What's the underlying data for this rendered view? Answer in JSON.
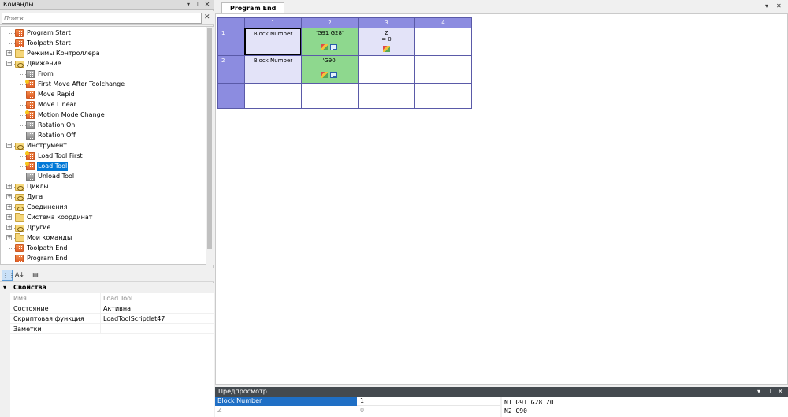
{
  "left_panel": {
    "title": "Команды",
    "search_placeholder": "Поиск...",
    "tree": [
      {
        "label": "Program Start",
        "icon": "red-block-icon",
        "level": 1,
        "expander": ""
      },
      {
        "label": "Toolpath Start",
        "icon": "red-block-icon",
        "level": 1,
        "expander": ""
      },
      {
        "label": "Режимы Контроллера",
        "icon": "folder-icon",
        "level": 1,
        "expander": "+"
      },
      {
        "label": "Движение",
        "icon": "folder-open-icon",
        "level": 1,
        "expander": "−"
      },
      {
        "label": "From",
        "icon": "grey-block-icon",
        "level": 2,
        "expander": ""
      },
      {
        "label": "First Move After Toolchange",
        "icon": "red-star-block-icon",
        "level": 2,
        "expander": ""
      },
      {
        "label": "Move Rapid",
        "icon": "red-block-icon",
        "level": 2,
        "expander": ""
      },
      {
        "label": "Move Linear",
        "icon": "red-block-icon",
        "level": 2,
        "expander": ""
      },
      {
        "label": "Motion Mode Change",
        "icon": "red-star-block-icon",
        "level": 2,
        "expander": ""
      },
      {
        "label": "Rotation On",
        "icon": "grey-block-icon",
        "level": 2,
        "expander": ""
      },
      {
        "label": "Rotation Off",
        "icon": "grey-block-icon",
        "level": 2,
        "expander": ""
      },
      {
        "label": "Инструмент",
        "icon": "folder-open-icon",
        "level": 1,
        "expander": "−"
      },
      {
        "label": "Load Tool First",
        "icon": "red-star-block-icon",
        "level": 2,
        "expander": ""
      },
      {
        "label": "Load Tool",
        "icon": "red-star-block-icon",
        "level": 2,
        "expander": "",
        "selected": true
      },
      {
        "label": "Unload Tool",
        "icon": "grey-block-icon",
        "level": 2,
        "expander": ""
      },
      {
        "label": "Циклы",
        "icon": "folder-open-icon",
        "level": 1,
        "expander": "+"
      },
      {
        "label": "Дуга",
        "icon": "folder-open-icon",
        "level": 1,
        "expander": "+"
      },
      {
        "label": "Соединения",
        "icon": "folder-open-icon",
        "level": 1,
        "expander": "+"
      },
      {
        "label": "Система координат",
        "icon": "folder-icon",
        "level": 1,
        "expander": "+"
      },
      {
        "label": "Другие",
        "icon": "folder-open-icon",
        "level": 1,
        "expander": "+"
      },
      {
        "label": "Мои команды",
        "icon": "folder-icon",
        "level": 1,
        "expander": "+"
      },
      {
        "label": "Toolpath End",
        "icon": "red-block-icon",
        "level": 1,
        "expander": ""
      },
      {
        "label": "Program End",
        "icon": "red-block-icon",
        "level": 1,
        "expander": ""
      }
    ]
  },
  "properties": {
    "category": "Свойства",
    "rows": [
      {
        "key": "Имя",
        "value": "Load Tool",
        "disabled": true
      },
      {
        "key": "Состояние",
        "value": "Активна",
        "disabled": false
      },
      {
        "key": "Скриптовая функция",
        "value": "LoadToolScriptlet47",
        "disabled": false
      },
      {
        "key": "Заметки",
        "value": "",
        "disabled": false
      }
    ],
    "toolbar": {
      "categorized_icon": "categorized-icon",
      "sort_icon": "sort-az-icon",
      "pages_icon": "property-pages-icon"
    }
  },
  "document": {
    "tab_label": "Program End",
    "columns": [
      "1",
      "2",
      "3",
      "4"
    ],
    "rows": [
      {
        "num": "1",
        "cells": [
          "Block Number",
          "'G91 G28'",
          "Z\n= 0",
          ""
        ]
      },
      {
        "num": "2",
        "cells": [
          "Block Number",
          "'G90'",
          "",
          ""
        ]
      },
      {
        "num": "",
        "cells": [
          "",
          "",
          "",
          ""
        ]
      }
    ],
    "colors": {
      "header": "#8c8ce0",
      "lavender": "#e3e3f8",
      "green": "#8ed88e"
    }
  },
  "preview": {
    "title": "Предпросмотр",
    "rows": [
      {
        "key": "Block Number",
        "value": "1",
        "selected": true
      },
      {
        "key": "Z",
        "value": "0",
        "disabled": true
      }
    ],
    "code_lines": [
      "N1 G91 G28 Z0",
      "N2 G90"
    ]
  }
}
